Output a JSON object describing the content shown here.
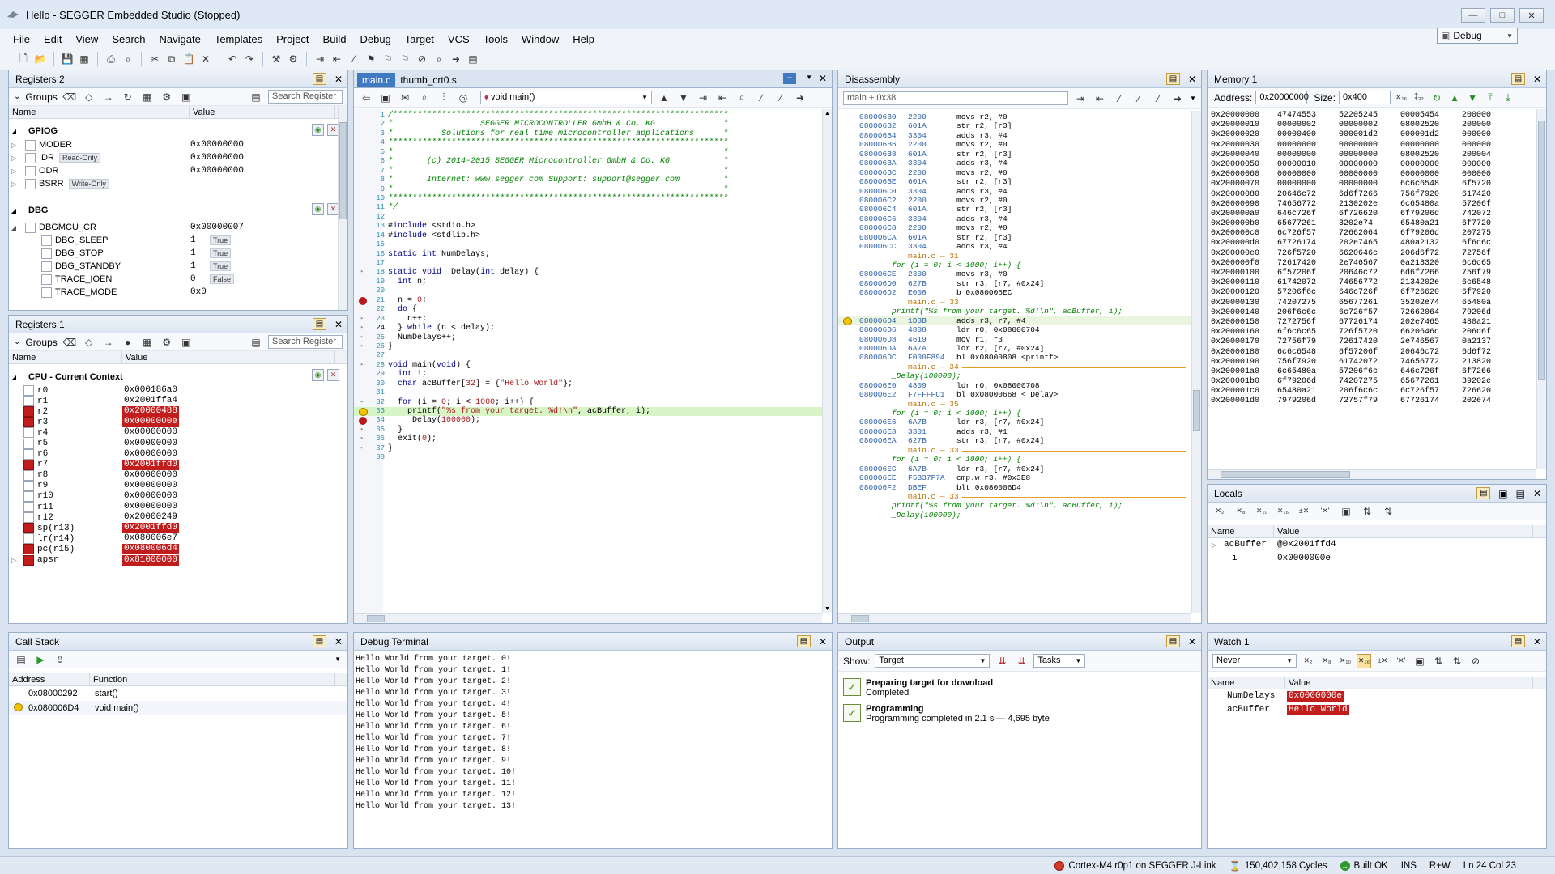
{
  "window": {
    "title": "Hello - SEGGER Embedded Studio (Stopped)",
    "controls": [
      "—",
      "□",
      "✕"
    ]
  },
  "menu": [
    "File",
    "Edit",
    "View",
    "Search",
    "Navigate",
    "Templates",
    "Project",
    "Build",
    "Debug",
    "Target",
    "VCS",
    "Tools",
    "Window",
    "Help"
  ],
  "config": "Debug",
  "registers2": {
    "title": "Registers 2",
    "groups_label": "Groups",
    "search_placeholder": "Search Register",
    "cols": [
      "Name",
      "Value"
    ],
    "groups": [
      {
        "name": "GPIOG",
        "rows": [
          {
            "name": "MODER",
            "value": "0x00000000",
            "tag": ""
          },
          {
            "name": "IDR",
            "value": "0x00000000",
            "tag": "Read-Only"
          },
          {
            "name": "ODR",
            "value": "0x00000000",
            "tag": ""
          },
          {
            "name": "BSRR",
            "value": "",
            "tag": "Write-Only"
          }
        ]
      },
      {
        "name": "DBG",
        "rows": []
      }
    ],
    "dbgmcu": {
      "name": "DBGMCU_CR",
      "value": "0x00000007",
      "children": [
        {
          "name": "DBG_SLEEP",
          "value": "1",
          "tag": "True"
        },
        {
          "name": "DBG_STOP",
          "value": "1",
          "tag": "True"
        },
        {
          "name": "DBG_STANDBY",
          "value": "1",
          "tag": "True"
        },
        {
          "name": "TRACE_IOEN",
          "value": "0",
          "tag": "False"
        },
        {
          "name": "TRACE_MODE",
          "value": "0x0",
          "tag": ""
        }
      ]
    }
  },
  "registers1": {
    "title": "Registers 1",
    "groups_label": "Groups",
    "search_placeholder": "Search Register",
    "cols": [
      "Name",
      "Value"
    ],
    "group": "CPU - Current Context",
    "rows": [
      {
        "name": "r0",
        "value": "0x000186a0",
        "hl": false
      },
      {
        "name": "r1",
        "value": "0x2001ffa4",
        "hl": false
      },
      {
        "name": "r2",
        "value": "0x20000488",
        "hl": true
      },
      {
        "name": "r3",
        "value": "0x0000000e",
        "hl": true
      },
      {
        "name": "r4",
        "value": "0x00000000",
        "hl": false
      },
      {
        "name": "r5",
        "value": "0x00000000",
        "hl": false
      },
      {
        "name": "r6",
        "value": "0x00000000",
        "hl": false
      },
      {
        "name": "r7",
        "value": "0x2001ffd0",
        "hl": true
      },
      {
        "name": "r8",
        "value": "0x00000000",
        "hl": false
      },
      {
        "name": "r9",
        "value": "0x00000000",
        "hl": false
      },
      {
        "name": "r10",
        "value": "0x00000000",
        "hl": false
      },
      {
        "name": "r11",
        "value": "0x00000000",
        "hl": false
      },
      {
        "name": "r12",
        "value": "0x20000249",
        "hl": false
      },
      {
        "name": "sp(r13)",
        "value": "0x2001ffd0",
        "hl": true
      },
      {
        "name": "lr(r14)",
        "value": "0x080006e7",
        "hl": false
      },
      {
        "name": "pc(r15)",
        "value": "0x080006d4",
        "hl": true
      },
      {
        "name": "apsr",
        "value": "0x81000000",
        "hl": true
      }
    ]
  },
  "editor": {
    "tabs": [
      "main.c",
      "thumb_crt0.s"
    ],
    "function": "void main()",
    "lines": [
      "/*********************************************************************",
      "*                  SEGGER MICROCONTROLLER GmbH & Co. KG              *",
      "*          Solutions for real time microcontroller applications      *",
      "**********************************************************************",
      "*                                                                    *",
      "*       (c) 2014-2015 SEGGER Microcontroller GmbH & Co. KG           *",
      "*                                                                    *",
      "*       Internet: www.segger.com Support: support@segger.com         *",
      "*                                                                    *",
      "**********************************************************************",
      "*/",
      "",
      "#include <stdio.h>",
      "#include <stdlib.h>",
      "",
      "static int NumDelays;",
      "",
      "static void _Delay(int delay) {",
      "  int n;",
      "",
      "  n = 0;",
      "  do {",
      "    n++;",
      "  } while (n < delay);",
      "  NumDelays++;",
      "}",
      "",
      "void main(void) {",
      "  int i;",
      "  char acBuffer[32] = {\"Hello World\"};",
      "",
      "  for (i = 0; i < 1000; i++) {",
      "    printf(\"%s from your target. %d!\\n\", acBuffer, i);",
      "    _Delay(100000);",
      "  }",
      "  exit(0);",
      "}",
      ""
    ]
  },
  "disassembly": {
    "title": "Disassembly",
    "location": "main + 0x38",
    "rows": [
      {
        "t": "i",
        "a": "080006B0",
        "h": "2200",
        "s": "movs r2, #0"
      },
      {
        "t": "i",
        "a": "080006B2",
        "h": "601A",
        "s": "str r2, [r3]"
      },
      {
        "t": "i",
        "a": "080006B4",
        "h": "3304",
        "s": "adds r3, #4"
      },
      {
        "t": "i",
        "a": "080006B6",
        "h": "2200",
        "s": "movs r2, #0"
      },
      {
        "t": "i",
        "a": "080006B8",
        "h": "601A",
        "s": "str r2, [r3]"
      },
      {
        "t": "i",
        "a": "080006BA",
        "h": "3304",
        "s": "adds r3, #4"
      },
      {
        "t": "i",
        "a": "080006BC",
        "h": "2200",
        "s": "movs r2, #0"
      },
      {
        "t": "i",
        "a": "080006BE",
        "h": "601A",
        "s": "str r2, [r3]"
      },
      {
        "t": "i",
        "a": "080006C0",
        "h": "3304",
        "s": "adds r3, #4"
      },
      {
        "t": "i",
        "a": "080006C2",
        "h": "2200",
        "s": "movs r2, #0"
      },
      {
        "t": "i",
        "a": "080006C4",
        "h": "601A",
        "s": "str r2, [r3]"
      },
      {
        "t": "i",
        "a": "080006C6",
        "h": "3304",
        "s": "adds r3, #4"
      },
      {
        "t": "i",
        "a": "080006C8",
        "h": "2200",
        "s": "movs r2, #0"
      },
      {
        "t": "i",
        "a": "080006CA",
        "h": "601A",
        "s": "str r2, [r3]"
      },
      {
        "t": "i",
        "a": "080006CC",
        "h": "3304",
        "s": "adds r3, #4"
      },
      {
        "t": "l",
        "s": "main.c — 31"
      },
      {
        "t": "c",
        "s": "for (i = 0; i < 1000; i++) {"
      },
      {
        "t": "i",
        "a": "080006CE",
        "h": "2300",
        "s": "movs r3, #0"
      },
      {
        "t": "i",
        "a": "080006D0",
        "h": "627B",
        "s": "str r3, [r7, #0x24]"
      },
      {
        "t": "i",
        "a": "080006D2",
        "h": "E008",
        "s": "b 0x080006EC"
      },
      {
        "t": "l",
        "s": "main.c — 33"
      },
      {
        "t": "c",
        "s": "printf(\"%s from your target. %d!\\n\", acBuffer, i);"
      },
      {
        "t": "p",
        "a": "080006D4",
        "h": "1D3B",
        "s": "adds r3, r7, #4"
      },
      {
        "t": "i",
        "a": "080006D6",
        "h": "4808",
        "s": "ldr r0, 0x08000704"
      },
      {
        "t": "i",
        "a": "080006D8",
        "h": "4619",
        "s": "mov r1, r3"
      },
      {
        "t": "i",
        "a": "080006DA",
        "h": "6A7A",
        "s": "ldr r2, [r7, #0x24]"
      },
      {
        "t": "i",
        "a": "080006DC",
        "h": "F000F894",
        "s": "bl 0x08000808 <printf>"
      },
      {
        "t": "l",
        "s": "main.c — 34"
      },
      {
        "t": "c",
        "s": "_Delay(100000);"
      },
      {
        "t": "i",
        "a": "080006E0",
        "h": "4809",
        "s": "ldr r0, 0x08000708"
      },
      {
        "t": "i",
        "a": "080006E2",
        "h": "F7FFFFC1",
        "s": "bl 0x08000668 <_Delay>"
      },
      {
        "t": "l",
        "s": "main.c — 35"
      },
      {
        "t": "c",
        "s": "for (i = 0; i < 1000; i++) {"
      },
      {
        "t": "i",
        "a": "080006E6",
        "h": "6A7B",
        "s": "ldr r3, [r7, #0x24]"
      },
      {
        "t": "i",
        "a": "080006E8",
        "h": "3301",
        "s": "adds r3, #1"
      },
      {
        "t": "i",
        "a": "080006EA",
        "h": "627B",
        "s": "str r3, [r7, #0x24]"
      },
      {
        "t": "l",
        "s": "main.c — 33"
      },
      {
        "t": "c",
        "s": "for (i = 0; i < 1000; i++) {"
      },
      {
        "t": "i",
        "a": "080006EC",
        "h": "6A7B",
        "s": "ldr r3, [r7, #0x24]"
      },
      {
        "t": "i",
        "a": "080006EE",
        "h": "F5B37F7A",
        "s": "cmp.w r3, #0x3E8"
      },
      {
        "t": "i",
        "a": "080006F2",
        "h": "DBEF",
        "s": "blt 0x080006D4"
      },
      {
        "t": "l",
        "s": "main.c — 33"
      },
      {
        "t": "c",
        "s": "printf(\"%s from your target. %d!\\n\", acBuffer, i);"
      },
      {
        "t": "c",
        "s": "_Delay(100000);"
      }
    ]
  },
  "memory": {
    "title": "Memory 1",
    "address_label": "Address:",
    "address": "0x20000000",
    "size_label": "Size:",
    "size": "0x400",
    "rows": [
      [
        "0x20000000",
        "47474553",
        "52205245",
        "00005454",
        "200000"
      ],
      [
        "0x20000010",
        "00000002",
        "00000002",
        "08002520",
        "200000"
      ],
      [
        "0x20000020",
        "00000400",
        "000001d2",
        "000001d2",
        "000000"
      ],
      [
        "0x20000030",
        "00000000",
        "00000000",
        "00000000",
        "000000"
      ],
      [
        "0x20000040",
        "00000000",
        "00000000",
        "08002520",
        "200004"
      ],
      [
        "0x20000050",
        "00000010",
        "00000000",
        "00000000",
        "000000"
      ],
      [
        "0x20000060",
        "00000000",
        "00000000",
        "00000000",
        "000000"
      ],
      [
        "0x20000070",
        "00000000",
        "00000000",
        "6c6c6548",
        "6f5720"
      ],
      [
        "0x20000080",
        "20646c72",
        "6d6f7266",
        "756f7920",
        "617420"
      ],
      [
        "0x20000090",
        "74656772",
        "2130202e",
        "6c65480a",
        "57206f"
      ],
      [
        "0x200000a0",
        "646c726f",
        "6f726620",
        "6f79206d",
        "742072"
      ],
      [
        "0x200000b0",
        "65677261",
        "3202e74",
        "65480a21",
        "6f7720"
      ],
      [
        "0x200000c0",
        "6c726f57",
        "72662064",
        "6f79206d",
        "207275"
      ],
      [
        "0x200000d0",
        "67726174",
        "202e7465",
        "480a2132",
        "6f6c6c"
      ],
      [
        "0x200000e0",
        "726f5720",
        "6620646c",
        "206d6f72",
        "72756f"
      ],
      [
        "0x200000f0",
        "72617420",
        "2e746567",
        "0a213320",
        "6c6c65"
      ],
      [
        "0x20000100",
        "6f57206f",
        "20646c72",
        "6d6f7266",
        "756f79"
      ],
      [
        "0x20000110",
        "61742072",
        "74656772",
        "2134202e",
        "6c6548"
      ],
      [
        "0x20000120",
        "57206f6c",
        "646c726f",
        "6f726620",
        "6f7920"
      ],
      [
        "0x20000130",
        "74207275",
        "65677261",
        "35202e74",
        "65480a"
      ],
      [
        "0x20000140",
        "206f6c6c",
        "6c726f57",
        "72662064",
        "79206d"
      ],
      [
        "0x20000150",
        "7272756f",
        "67726174",
        "202e7465",
        "480a21"
      ],
      [
        "0x20000160",
        "6f6c6c65",
        "726f5720",
        "6620646c",
        "206d6f"
      ],
      [
        "0x20000170",
        "72756f79",
        "72617420",
        "2e746567",
        "0a2137"
      ],
      [
        "0x20000180",
        "6c6c6548",
        "6f57206f",
        "20646c72",
        "6d6f72"
      ],
      [
        "0x20000190",
        "756f7920",
        "61742072",
        "74656772",
        "213820"
      ],
      [
        "0x200001a0",
        "6c65480a",
        "57206f6c",
        "646c726f",
        "6f7266"
      ],
      [
        "0x200001b0",
        "6f79206d",
        "74207275",
        "65677261",
        "39202e"
      ],
      [
        "0x200001c0",
        "65480a21",
        "206f6c6c",
        "6c726f57",
        "726620"
      ],
      [
        "0x200001d0",
        "7979206d",
        "72757f79",
        "67726174",
        "202e74"
      ]
    ]
  },
  "locals": {
    "title": "Locals",
    "cols": [
      "Name",
      "Value"
    ],
    "rows": [
      {
        "name": "acBuffer",
        "value": "@0x2001ffd4"
      },
      {
        "name": "i",
        "value": "0x0000000e"
      }
    ]
  },
  "callstack": {
    "title": "Call Stack",
    "cols": [
      "Address",
      "Function"
    ],
    "rows": [
      {
        "addr": "0x08000292",
        "fn": "start()",
        "current": false
      },
      {
        "addr": "0x080006D4",
        "fn": "void main()",
        "current": true
      }
    ]
  },
  "terminal": {
    "title": "Debug Terminal",
    "lines": [
      "Hello World from your target. 0!",
      "Hello World from your target. 1!",
      "Hello World from your target. 2!",
      "Hello World from your target. 3!",
      "Hello World from your target. 4!",
      "Hello World from your target. 5!",
      "Hello World from your target. 6!",
      "Hello World from your target. 7!",
      "Hello World from your target. 8!",
      "Hello World from your target. 9!",
      "Hello World from your target. 10!",
      "Hello World from your target. 11!",
      "Hello World from your target. 12!",
      "Hello World from your target. 13!"
    ]
  },
  "output": {
    "title": "Output",
    "show_label": "Show:",
    "show_value": "Target",
    "tasks": "Tasks",
    "items": [
      {
        "title": "Preparing target for download",
        "detail": "Completed"
      },
      {
        "title": "Programming",
        "detail": "Programming completed in 2.1 s — 4,695 byte"
      }
    ]
  },
  "watch": {
    "title": "Watch 1",
    "mode": "Never",
    "cols": [
      "Name",
      "Value"
    ],
    "rows": [
      {
        "name": "NumDelays",
        "value": "0x0000000e"
      },
      {
        "name": "acBuffer",
        "value": "Hello World"
      }
    ]
  },
  "status": {
    "target": "Cortex-M4 r0p1 on SEGGER J-Link",
    "cycles": "150,402,158 Cycles",
    "build": "Built OK",
    "ins": "INS",
    "rw": "R+W",
    "pos": "Ln 24 Col 23"
  }
}
